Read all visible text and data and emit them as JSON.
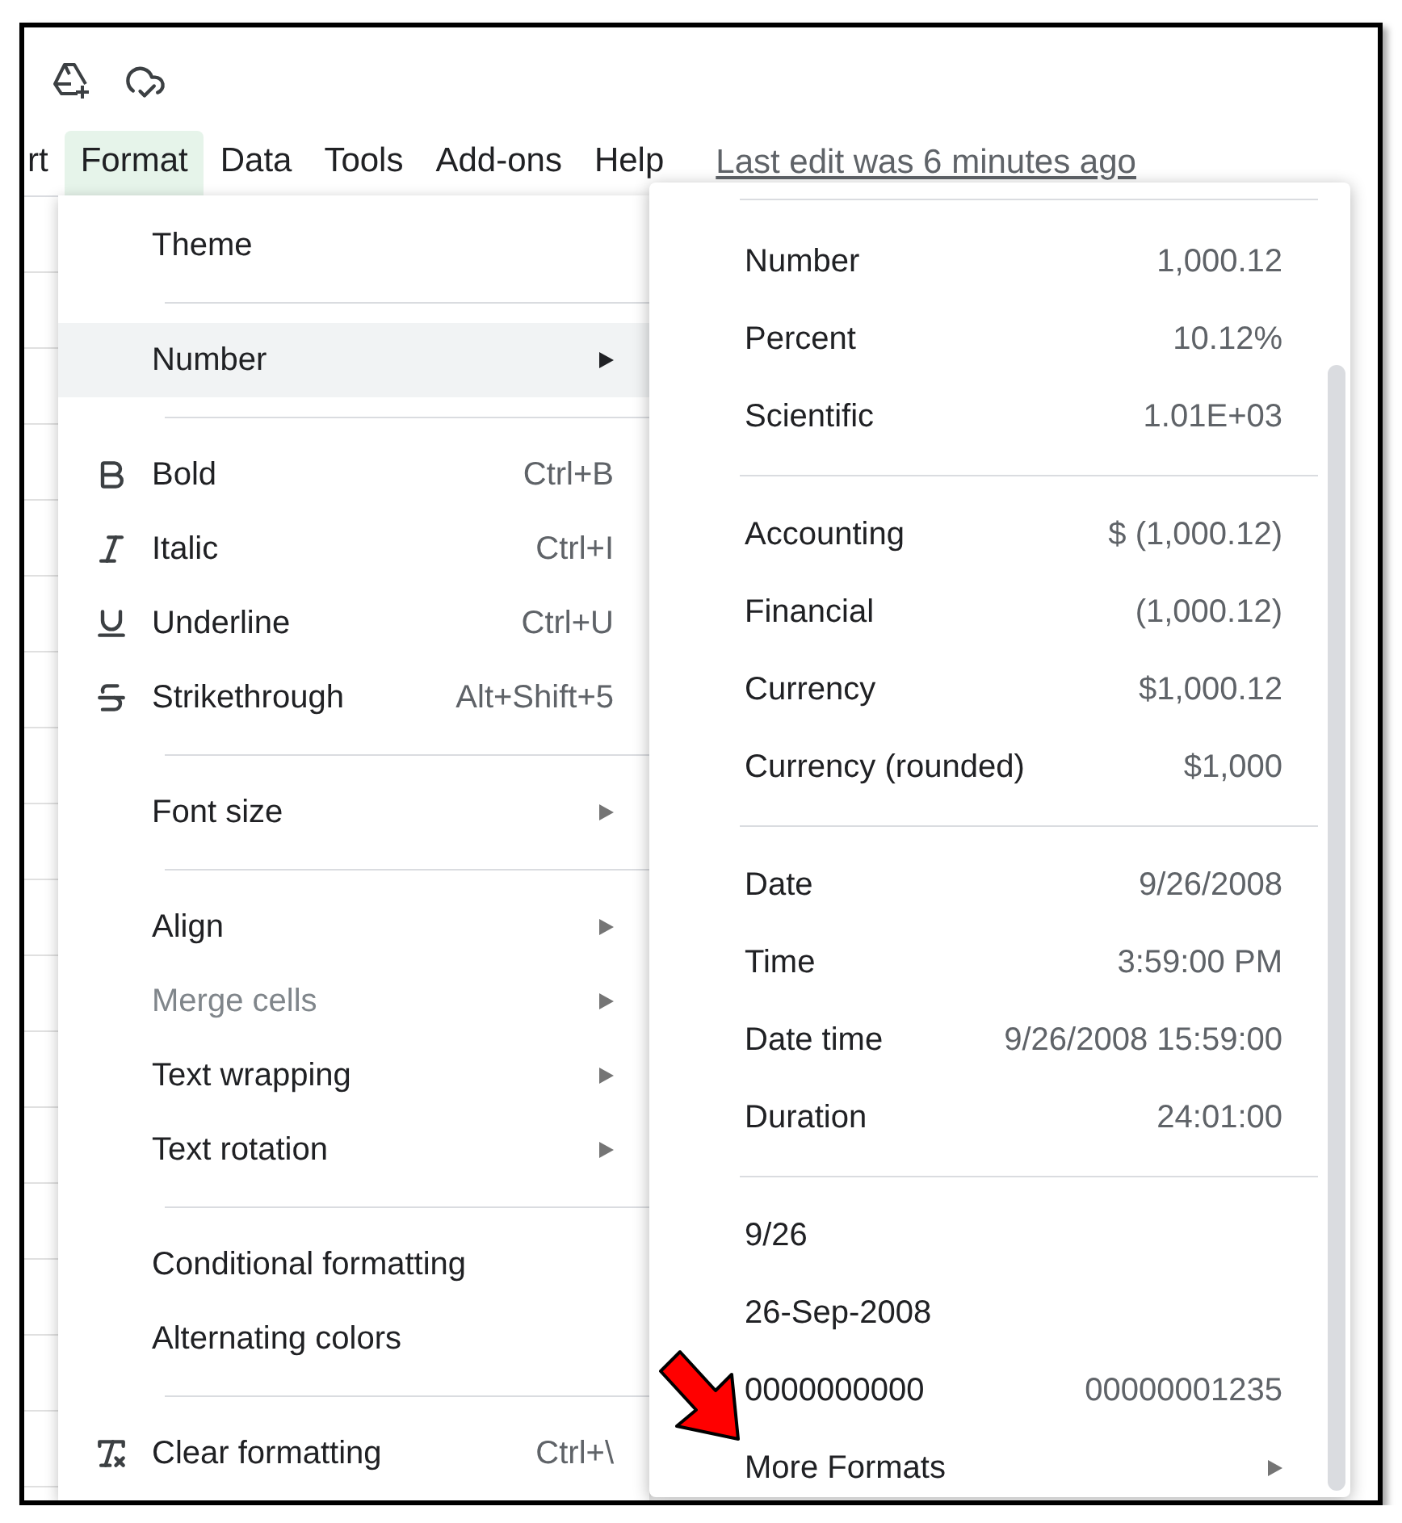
{
  "menubar": {
    "items": [
      {
        "label": "rt",
        "selected": false
      },
      {
        "label": "Format",
        "selected": true
      },
      {
        "label": "Data",
        "selected": false
      },
      {
        "label": "Tools",
        "selected": false
      },
      {
        "label": "Add-ons",
        "selected": false
      },
      {
        "label": "Help",
        "selected": false
      }
    ],
    "last_edit": "Last edit was 6 minutes ago"
  },
  "format_menu": {
    "sections": [
      [
        {
          "label": "Theme",
          "kind": "plain",
          "submenu": false,
          "selected": false,
          "disabled": false
        }
      ],
      [
        {
          "label": "Number",
          "kind": "plain",
          "submenu": true,
          "selected": true,
          "disabled": false
        }
      ],
      [
        {
          "label": "Bold",
          "kind": "bold",
          "shortcut": "Ctrl+B",
          "submenu": false,
          "selected": false,
          "disabled": false
        },
        {
          "label": "Italic",
          "kind": "italic",
          "shortcut": "Ctrl+I",
          "submenu": false,
          "selected": false,
          "disabled": false
        },
        {
          "label": "Underline",
          "kind": "underline",
          "shortcut": "Ctrl+U",
          "submenu": false,
          "selected": false,
          "disabled": false
        },
        {
          "label": "Strikethrough",
          "kind": "strikethrough",
          "shortcut": "Alt+Shift+5",
          "submenu": false,
          "selected": false,
          "disabled": false
        }
      ],
      [
        {
          "label": "Font size",
          "kind": "plain",
          "submenu": true,
          "selected": false,
          "disabled": false
        }
      ],
      [
        {
          "label": "Align",
          "kind": "plain",
          "submenu": true,
          "selected": false,
          "disabled": false
        },
        {
          "label": "Merge cells",
          "kind": "plain",
          "submenu": true,
          "selected": false,
          "disabled": true
        },
        {
          "label": "Text wrapping",
          "kind": "plain",
          "submenu": true,
          "selected": false,
          "disabled": false
        },
        {
          "label": "Text rotation",
          "kind": "plain",
          "submenu": true,
          "selected": false,
          "disabled": false
        }
      ],
      [
        {
          "label": "Conditional formatting",
          "kind": "plain",
          "submenu": false,
          "selected": false,
          "disabled": false
        },
        {
          "label": "Alternating colors",
          "kind": "plain",
          "submenu": false,
          "selected": false,
          "disabled": false
        }
      ],
      [
        {
          "label": "Clear formatting",
          "kind": "clear",
          "shortcut": "Ctrl+\\",
          "submenu": false,
          "selected": false,
          "disabled": false
        }
      ]
    ]
  },
  "number_menu": {
    "sections": [
      [
        {
          "label": "Number",
          "sample": "1,000.12",
          "submenu": false
        },
        {
          "label": "Percent",
          "sample": "10.12%",
          "submenu": false
        },
        {
          "label": "Scientific",
          "sample": "1.01E+03",
          "submenu": false
        }
      ],
      [
        {
          "label": "Accounting",
          "sample": "$ (1,000.12)",
          "submenu": false
        },
        {
          "label": "Financial",
          "sample": "(1,000.12)",
          "submenu": false
        },
        {
          "label": "Currency",
          "sample": "$1,000.12",
          "submenu": false
        },
        {
          "label": "Currency (rounded)",
          "sample": "$1,000",
          "submenu": false
        }
      ],
      [
        {
          "label": "Date",
          "sample": "9/26/2008",
          "submenu": false
        },
        {
          "label": "Time",
          "sample": "3:59:00 PM",
          "submenu": false
        },
        {
          "label": "Date time",
          "sample": "9/26/2008 15:59:00",
          "submenu": false
        },
        {
          "label": "Duration",
          "sample": "24:01:00",
          "submenu": false
        }
      ],
      [
        {
          "label": "9/26",
          "submenu": false
        },
        {
          "label": "26-Sep-2008",
          "submenu": false
        },
        {
          "label": "0000000000",
          "sample": "00000001235",
          "submenu": false
        },
        {
          "label": "More Formats",
          "submenu": true
        }
      ]
    ]
  }
}
